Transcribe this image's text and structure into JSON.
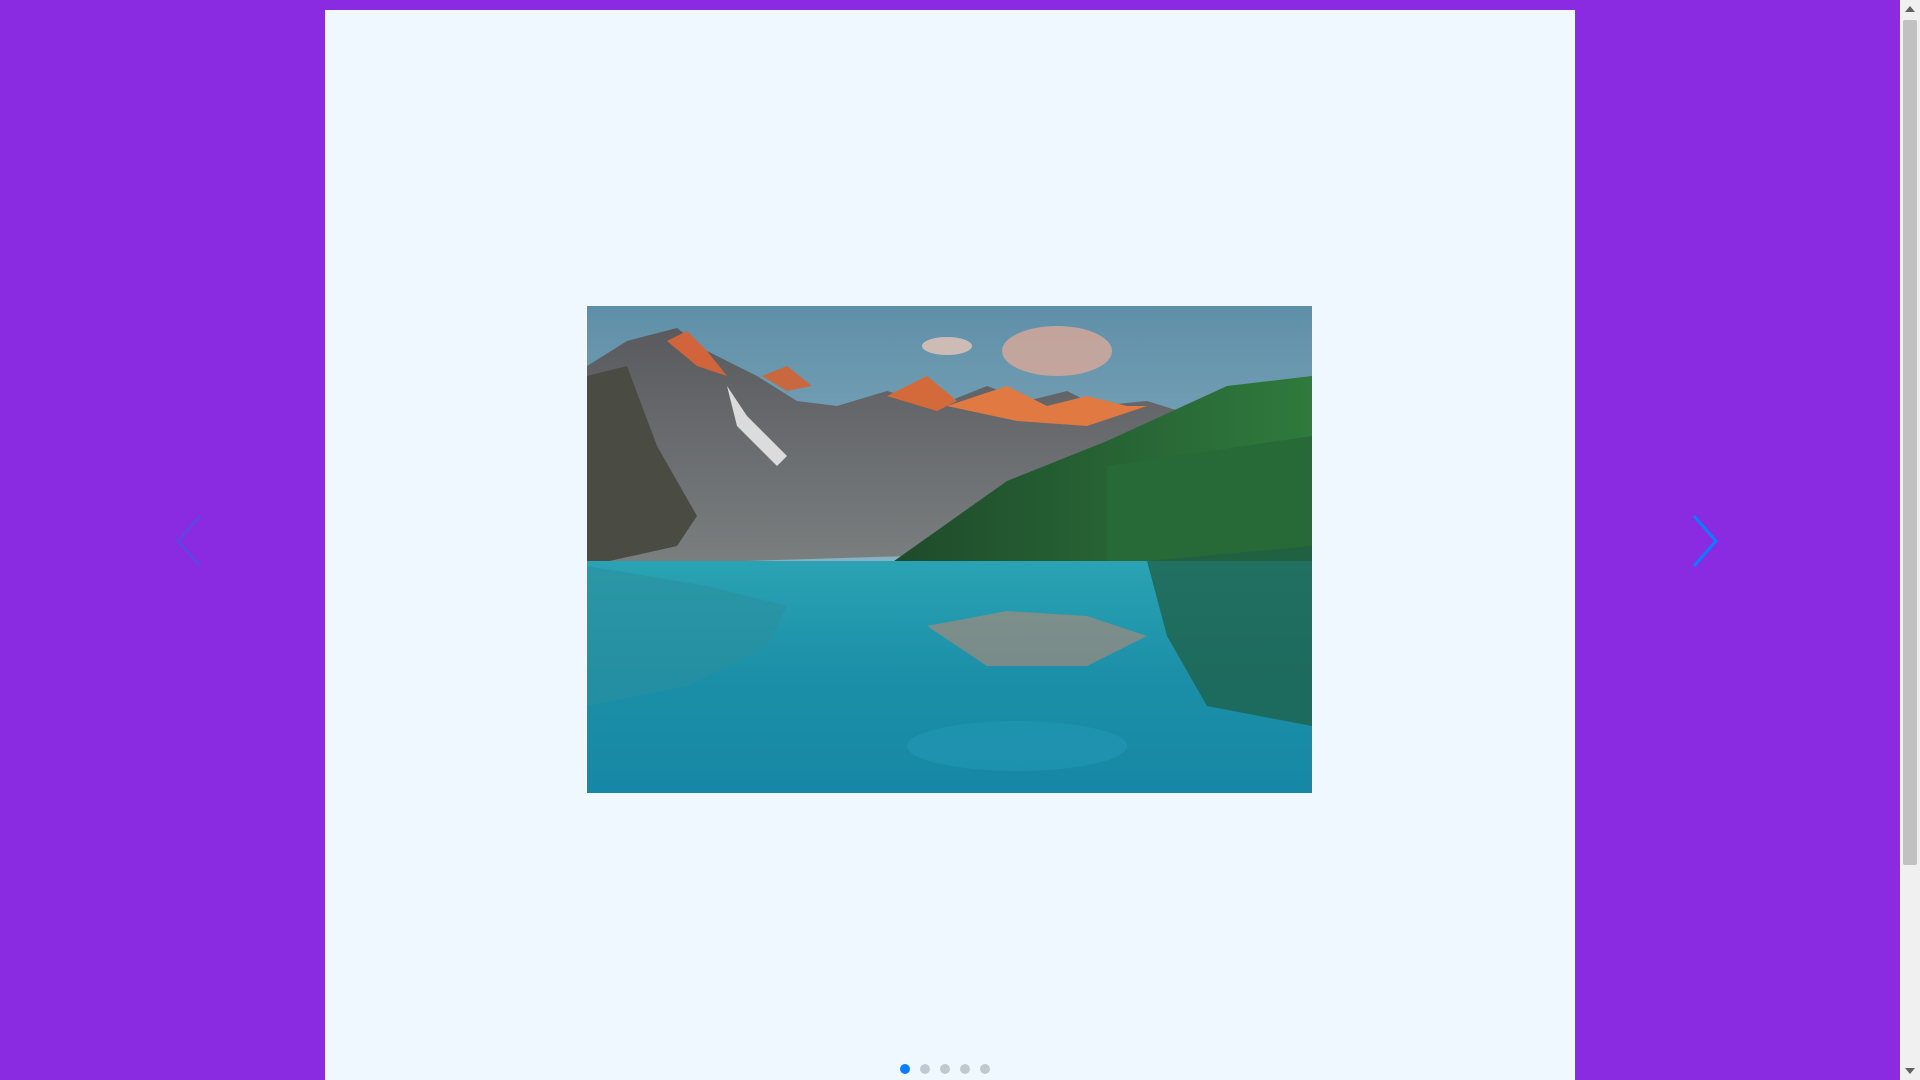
{
  "colors": {
    "page_background": "#8a2be2",
    "card_background": "#f0f8ff",
    "accent": "#0a7cff",
    "dot_inactive": "#c0c8d2"
  },
  "carousel": {
    "current_slide": 1,
    "slide_count": 5,
    "prev_icon": "chevron-left-icon",
    "next_icon": "chevron-right-icon",
    "image_subject": "mountain-lake-landscape"
  }
}
